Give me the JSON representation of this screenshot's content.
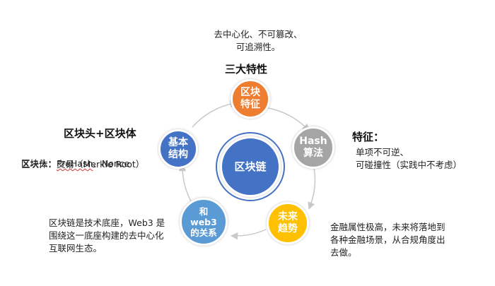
{
  "center": {
    "label": "区块链",
    "color": "#4472c4"
  },
  "nodes": {
    "features": {
      "label": "区块\n特征",
      "color": "#ed7d31"
    },
    "hash": {
      "label": "Hash\n算法",
      "color": "#a5a5a5"
    },
    "future": {
      "label": "未来\n趋势",
      "color": "#ffc000"
    },
    "web3": {
      "label": "和\nweb3\n的关系",
      "color": "#5b9bd5"
    },
    "structure": {
      "label": "基本\n结构",
      "color": "#4472c4"
    }
  },
  "annotations": {
    "features": {
      "desc": "去中心化、不可篡改、\n可追溯性。",
      "heading": "三大特性"
    },
    "hash": {
      "heading": "特征：",
      "desc": "单项不可逆、\n可碰撞性（实践中不考虑）"
    },
    "future": {
      "desc": "金融属性极高，未来将落地到\n各种金融场景，从合规角度出\n去做。"
    },
    "web3": {
      "desc": "区块链是技术底座，Web3 是\n围绕这一底座构建的去中心化\n互联网生态。"
    },
    "structure": {
      "heading": "区块头+区块体",
      "line1_label": "区块头：",
      "line1_pre": "PreHash",
      "line1_rest": "、Nonce",
      "line2": "区块体：交易（Merkle Root）"
    }
  },
  "colors": {
    "ring": "#c9c9c9"
  }
}
